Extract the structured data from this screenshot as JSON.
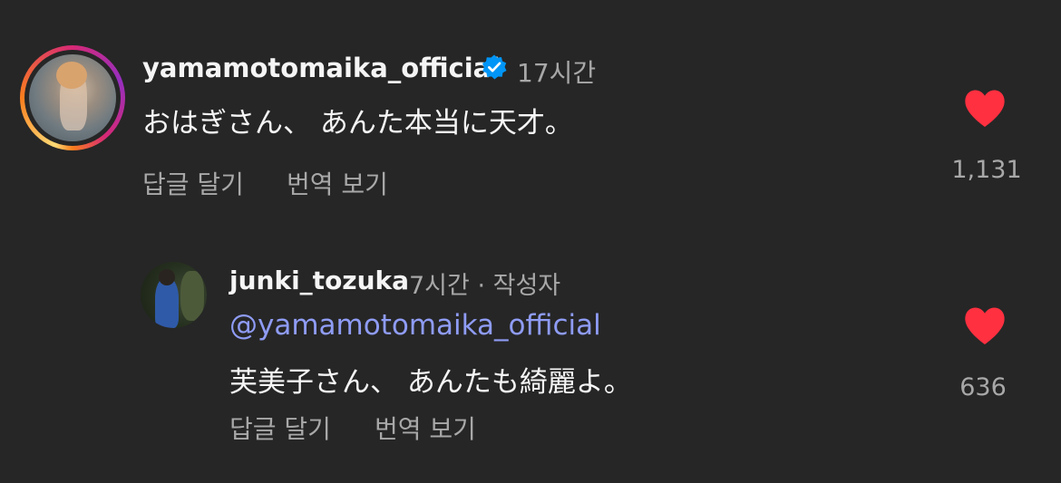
{
  "comment": {
    "username": "yamamotomaika_official",
    "verified": true,
    "time": "17시간",
    "text": "おはぎさん、 あんた本当に天才。",
    "reply_label": "답글 달기",
    "translate_label": "번역 보기",
    "like_count": "1,131",
    "liked": true
  },
  "reply": {
    "username": "junki_tozuka",
    "time": "7시간 · 작성자",
    "mention": "@yamamotomaika_official",
    "text": "芙美子さん、 あんたも綺麗よ。",
    "reply_label": "답글 달기",
    "translate_label": "번역 보기",
    "like_count": "636",
    "liked": true
  },
  "colors": {
    "background": "#262626",
    "heart": "#ff3040",
    "verified": "#0095f6",
    "mention": "#8f9cf5",
    "secondary_text": "#a8a8a8"
  },
  "icons": {
    "verified": "verified-badge-icon",
    "like": "heart-icon"
  }
}
